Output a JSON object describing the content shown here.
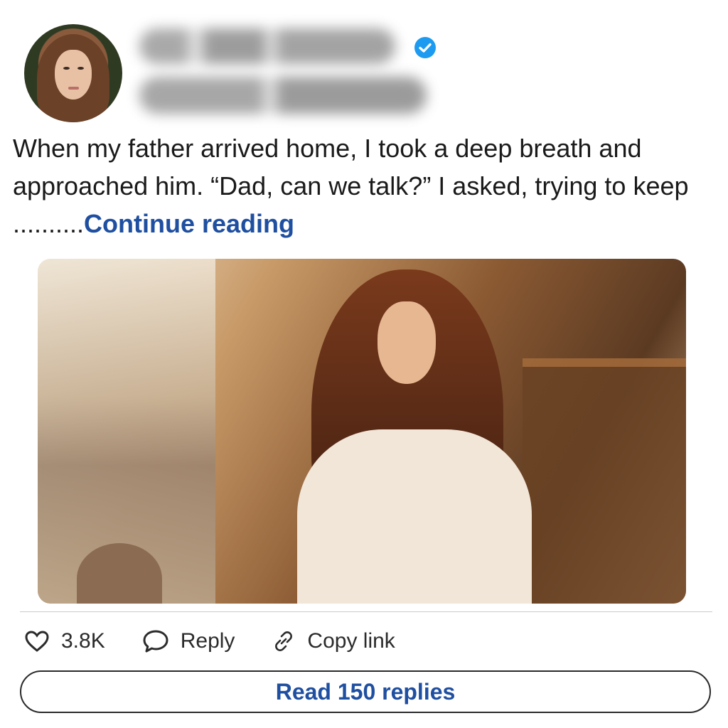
{
  "post": {
    "text": "When my father arrived home, I took a deep breath and approached him. “Dad, can we talk?” I asked, trying to keep ..........",
    "continue_label": "Continue reading"
  },
  "actions": {
    "likes": "3.8K",
    "reply_label": "Reply",
    "copy_label": "Copy link"
  },
  "read_replies_label": "Read 150 replies",
  "colors": {
    "link": "#1f4fa0",
    "verified": "#1d9bf0"
  }
}
